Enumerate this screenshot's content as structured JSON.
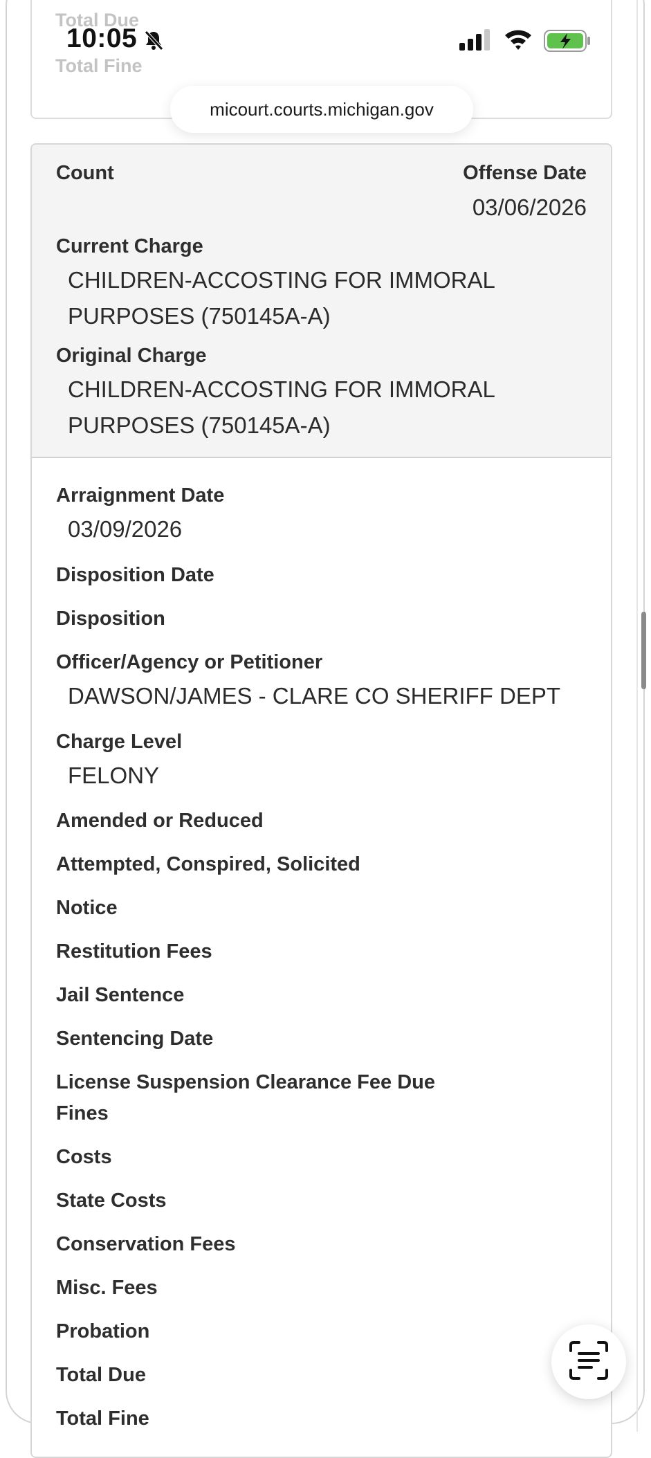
{
  "status_bar": {
    "time": "10:05"
  },
  "browser": {
    "url": "micourt.courts.michigan.gov"
  },
  "top_card": {
    "ghost_total_due": "Total Due",
    "ghost_total_fine": "Total Fine"
  },
  "charge_header": {
    "count_label": "Count",
    "offense_date_label": "Offense Date",
    "offense_date": "03/06/2026",
    "current_charge_label": "Current Charge",
    "current_charge_line1": "CHILDREN-ACCOSTING FOR IMMORAL",
    "current_charge_line2": "PURPOSES (750145A-A)",
    "original_charge_label": "Original Charge",
    "original_charge_line1": "CHILDREN-ACCOSTING FOR IMMORAL",
    "original_charge_line2": "PURPOSES (750145A-A)"
  },
  "details": {
    "arraignment_date_label": "Arraignment Date",
    "arraignment_date": "03/09/2026",
    "disposition_date_label": "Disposition Date",
    "disposition_label": "Disposition",
    "officer_label": "Officer/Agency or Petitioner",
    "officer_value": "DAWSON/JAMES - CLARE CO SHERIFF DEPT",
    "charge_level_label": "Charge Level",
    "charge_level": "FELONY",
    "amended_label": "Amended or Reduced",
    "attempted_label": "Attempted, Conspired, Solicited",
    "notice_label": "Notice",
    "restitution_label": "Restitution Fees",
    "jail_label": "Jail Sentence",
    "sentencing_label": "Sentencing Date",
    "license_fee_label": "License Suspension Clearance Fee Due",
    "fines_label": "Fines",
    "costs_label": "Costs",
    "state_costs_label": "State Costs",
    "conservation_label": "Conservation Fees",
    "misc_label": "Misc. Fees",
    "probation_label": "Probation",
    "total_due_label": "Total Due",
    "total_fine_label": "Total Fine"
  },
  "icons": {
    "bell": "bell-slash-icon",
    "signal": "cellular-signal-icon",
    "wifi": "wifi-icon",
    "battery": "battery-charging-icon",
    "fab": "live-text-scan-icon"
  },
  "colors": {
    "battery_fill": "#5ec24d",
    "header_bg": "#f4f4f4"
  }
}
